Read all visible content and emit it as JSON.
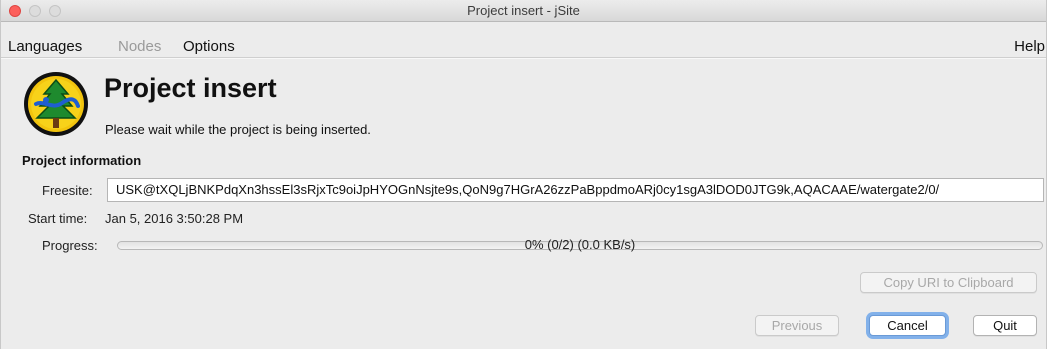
{
  "window": {
    "title": "Project insert - jSite"
  },
  "menubar": {
    "items": [
      {
        "label": "Languages",
        "enabled": true
      },
      {
        "label": "Nodes",
        "enabled": false
      },
      {
        "label": "Options",
        "enabled": true
      }
    ],
    "help_label": "Help"
  },
  "header": {
    "logo_icon": "jsite-logo-icon",
    "title": "Project insert",
    "subtitle": "Please wait while the project is being inserted."
  },
  "project_info": {
    "section_title": "Project information",
    "freesite_label": "Freesite:",
    "freesite_value": "USK@tXQLjBNKPdqXn3hssEl3sRjxTc9oiJpHYOGnNsjte9s,QoN9g7HGrA26zzPaBppdmoARj0cy1sgA3lDOD0JTG9k,AQACAAE/watergate2/0/",
    "start_time_label": "Start time:",
    "start_time_value": "Jan 5, 2016 3:50:28 PM",
    "progress_label": "Progress:",
    "progress_text": "0% (0/2) (0.0 KB/s)",
    "progress_fraction": 0
  },
  "buttons": {
    "copy_uri": "Copy URI to Clipboard",
    "previous": "Previous",
    "cancel": "Cancel",
    "quit": "Quit"
  },
  "colors": {
    "close_button": "#fc605c",
    "focus_ring": "#82b1ea",
    "window_background": "#ececec"
  }
}
